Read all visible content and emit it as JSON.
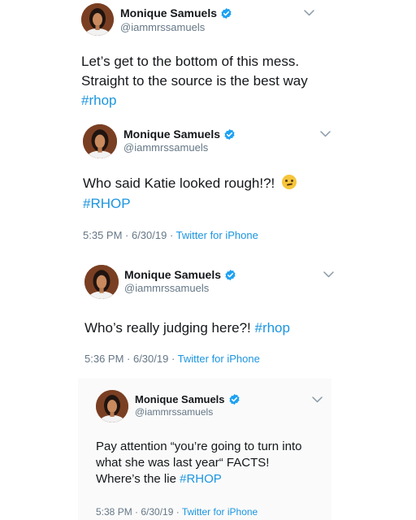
{
  "tweets": [
    {
      "name": "Monique Samuels",
      "handle": "@iammrssamuels",
      "lines": [
        {
          "text": "Let’s get to the bottom of this mess.",
          "hashtag": ""
        },
        {
          "text": "Straight to the source is the best way",
          "hashtag": ""
        },
        {
          "text": "",
          "hashtag": "#rhop"
        }
      ],
      "time": "",
      "source": ""
    },
    {
      "name": "Monique Samuels",
      "handle": "@iammrssamuels",
      "lines": [
        {
          "text": "Who said Katie looked rough!?! ",
          "hashtag": "",
          "emoji": "thinking-face-emoji"
        },
        {
          "text": "",
          "hashtag": "#RHOP"
        }
      ],
      "time": "5:35 PM · 6/30/19 · ",
      "source": "Twitter for iPhone"
    },
    {
      "name": "Monique Samuels",
      "handle": "@iammrssamuels",
      "lines": [
        {
          "text": "Who’s really judging here?! ",
          "hashtag": "#rhop"
        }
      ],
      "time": "5:36 PM · 6/30/19 · ",
      "source": "Twitter for iPhone"
    },
    {
      "name": "Monique Samuels",
      "handle": "@iammrssamuels",
      "lines": [
        {
          "text": "Pay attention “you’re going to turn into",
          "hashtag": ""
        },
        {
          "text": "what she was last year“ FACTS!",
          "hashtag": ""
        },
        {
          "text": "Where’s the lie ",
          "hashtag": "#RHOP"
        }
      ],
      "time": "5:38 PM · 6/30/19 · ",
      "source": "Twitter for iPhone"
    }
  ],
  "colors": {
    "hashtag": "#1b95e0",
    "handle": "#657786",
    "verified": "#1da1f2",
    "text": "#14171a"
  }
}
